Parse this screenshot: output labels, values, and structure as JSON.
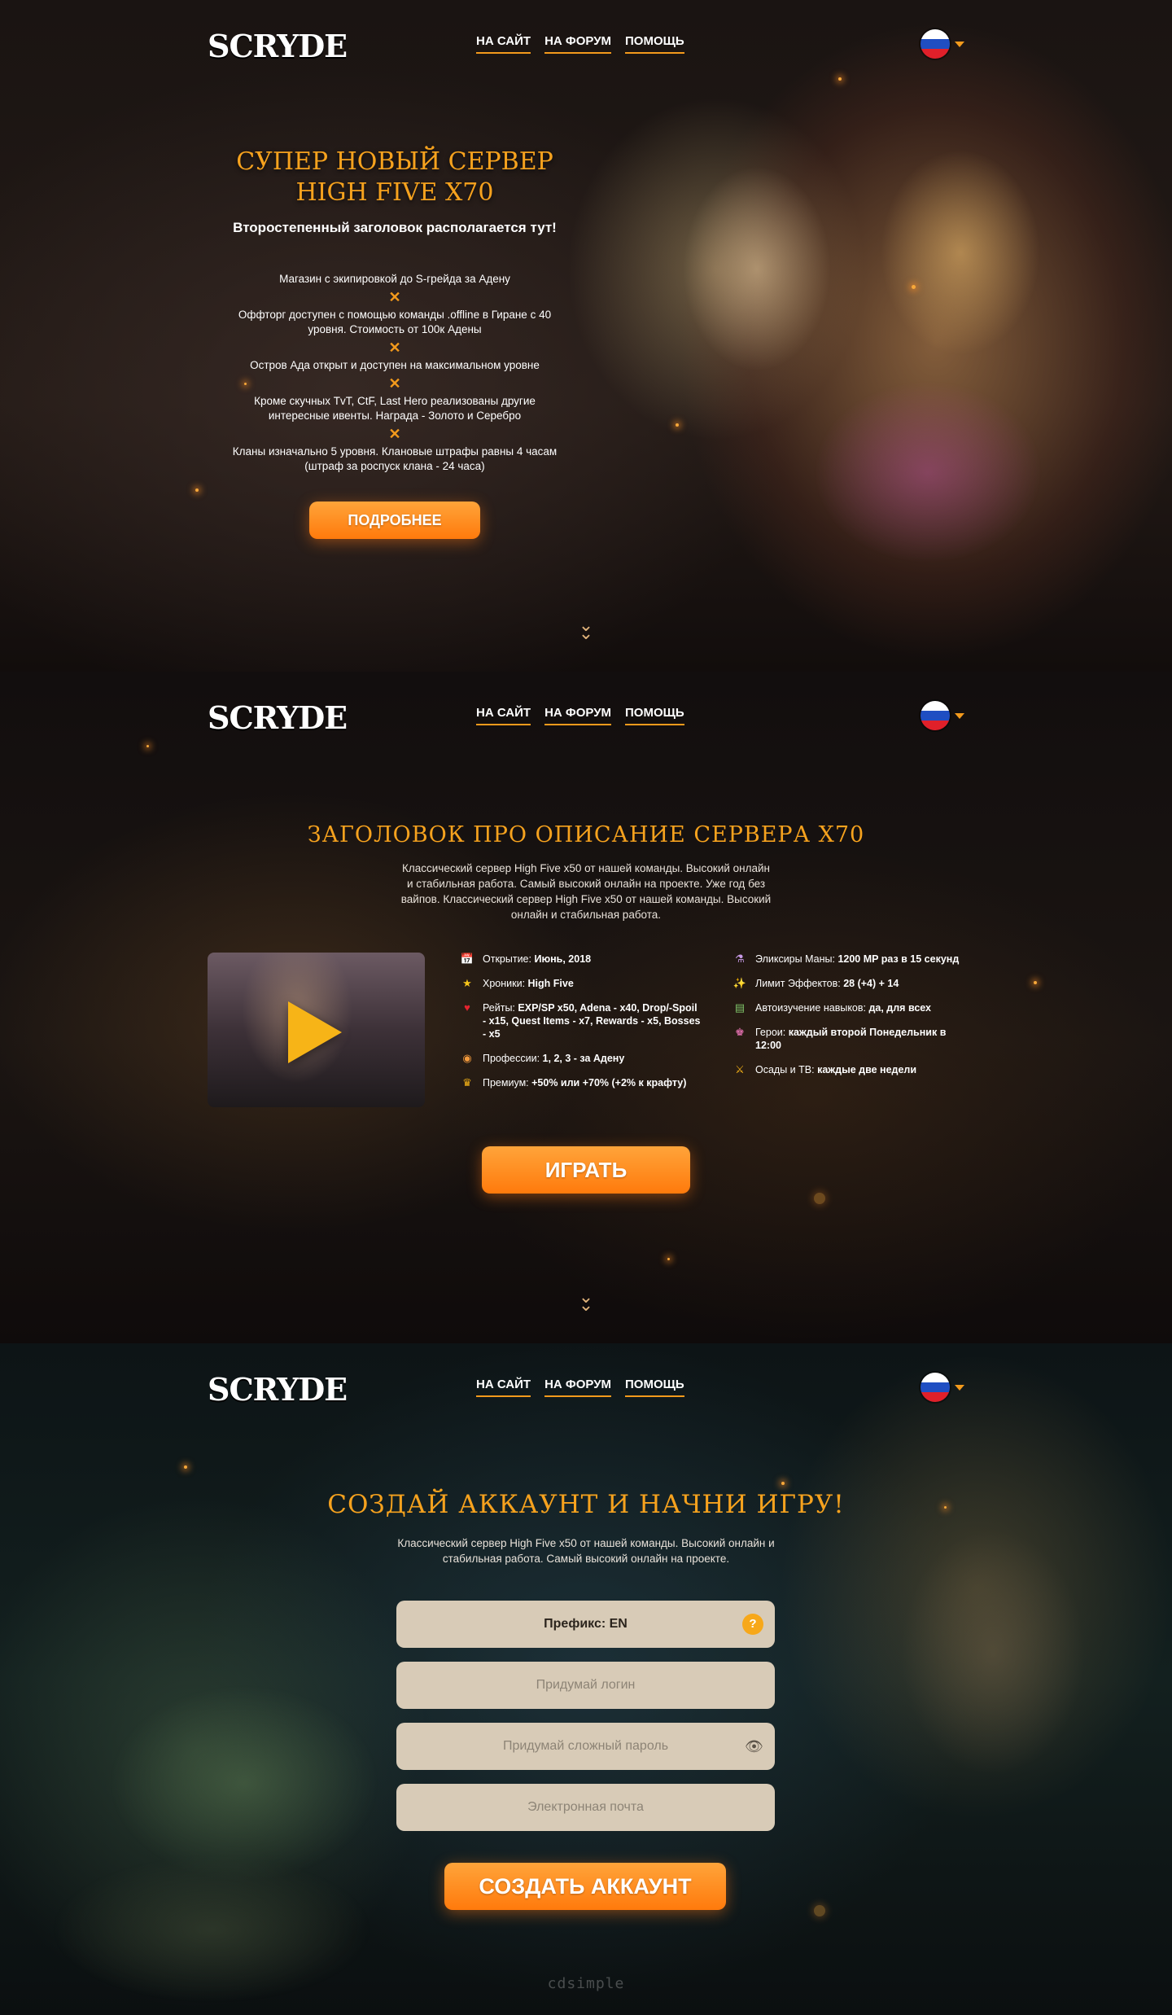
{
  "header": {
    "logo": "SCRYDE",
    "nav": [
      "НА САЙТ",
      "НА ФОРУМ",
      "ПОМОЩЬ"
    ],
    "language": "ru-flag"
  },
  "hero": {
    "title_line1": "СУПЕР НОВЫЙ СЕРВЕР",
    "title_line2": "HIGH FIVE X70",
    "subtitle": "Второстепенный заголовок располагается тут!",
    "features": [
      "Магазин с экипировкой до S-грейда за Адену",
      "Оффторг доступен с помощью команды .offline в Гиране с 40 уровня. Стоимость от 100к Адены",
      "Остров Ада открыт и доступен на максимальном уровне",
      "Кроме скучных TvT, CtF, Last Hero реализованы другие интересные ивенты. Награда - Золото и Серебро",
      "Кланы изначально 5 уровня. Клановые штрафы равны 4 часам (штраф за роспуск клана - 24 часа)"
    ],
    "separator": "✕",
    "button": "ПОДРОБНЕЕ",
    "scroll_icon": "⌄"
  },
  "about": {
    "title": "ЗАГОЛОВОК ПРО ОПИСАНИЕ СЕРВЕРА X70",
    "description": "Классический сервер High Five x50 от нашей команды. Высокий онлайн и стабильная работа. Самый высокий онлайн на проекте. Уже год без вайпов. Классический сервер High Five x50 от нашей команды. Высокий онлайн и стабильная работа.",
    "stats_left": [
      {
        "icon": "calendar-icon",
        "glyph": "📅",
        "label": "Открытие: ",
        "value": "Июнь, 2018"
      },
      {
        "icon": "star-icon",
        "glyph": "★",
        "label": "Хроники: ",
        "value": "High Five"
      },
      {
        "icon": "heart-icon",
        "glyph": "♥",
        "label": "Рейты: ",
        "value": "EXP/SP x50, Adena - x40, Drop/-Spoil - x15, Quest Items - x7, Rewards - x5, Bosses - x5"
      },
      {
        "icon": "donut-icon",
        "glyph": "◉",
        "label": "Профессии: ",
        "value": "1, 2, 3 - за Адену"
      },
      {
        "icon": "crown-icon",
        "glyph": "♛",
        "label": "Премиум: ",
        "value": "+50% или +70% (+2% к крафту)"
      }
    ],
    "stats_right": [
      {
        "icon": "potion-icon",
        "glyph": "⚗",
        "label": "Эликсиры Маны: ",
        "value": "1200 MP раз в 15 секунд"
      },
      {
        "icon": "wand-icon",
        "glyph": "✨",
        "label": "Лимит Эффектов: ",
        "value": "28 (+4) + 14"
      },
      {
        "icon": "books-icon",
        "glyph": "▤",
        "label": "Автоизучение навыков: ",
        "value": "да, для всех"
      },
      {
        "icon": "hero-icon",
        "glyph": "♚",
        "label": "Герои: ",
        "value": "каждый второй Понедельник в 12:00"
      },
      {
        "icon": "siege-icon",
        "glyph": "⚔",
        "label": "Осады и ТВ: ",
        "value": "каждые две недели"
      }
    ],
    "button": "ИГРАТЬ"
  },
  "register": {
    "title": "СОЗДАЙ АККАУНТ И НАЧНИ ИГРУ!",
    "description": "Классический сервер High Five x50 от нашей команды. Высокий онлайн и стабильная работа. Самый высокий онлайн на проекте.",
    "prefix": "Префикс: EN",
    "help": "?",
    "login_placeholder": "Придумай логин",
    "password_placeholder": "Придумай сложный пароль",
    "email_placeholder": "Электронная почта",
    "button": "СОЗДАТЬ АККАУНТ",
    "watermark": "cdsimple"
  },
  "colors": {
    "accent": "#f6a21e",
    "button": "#ff8a1c",
    "field": "#d8cbb7"
  }
}
